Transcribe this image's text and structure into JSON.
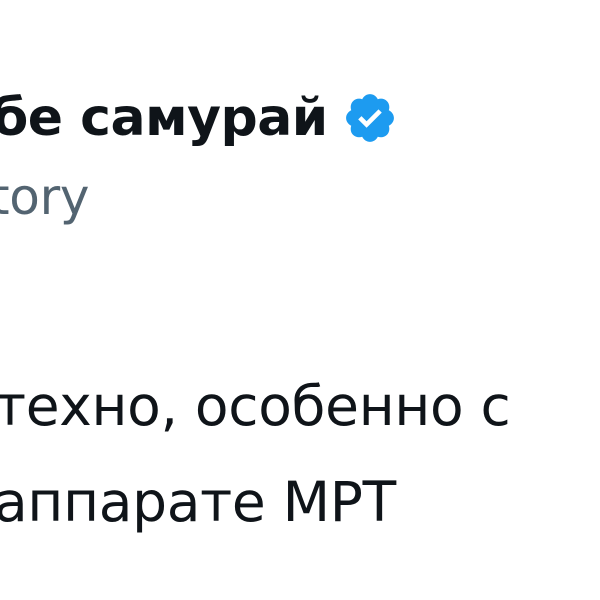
{
  "author": {
    "display_name": "бе самурай",
    "handle": "tory",
    "verified_icon": "verified-check-icon",
    "badge_color": "#1d9bf0"
  },
  "tweet": {
    "lines": [
      "техно, особенно с",
      "аппарате МРТ"
    ]
  }
}
